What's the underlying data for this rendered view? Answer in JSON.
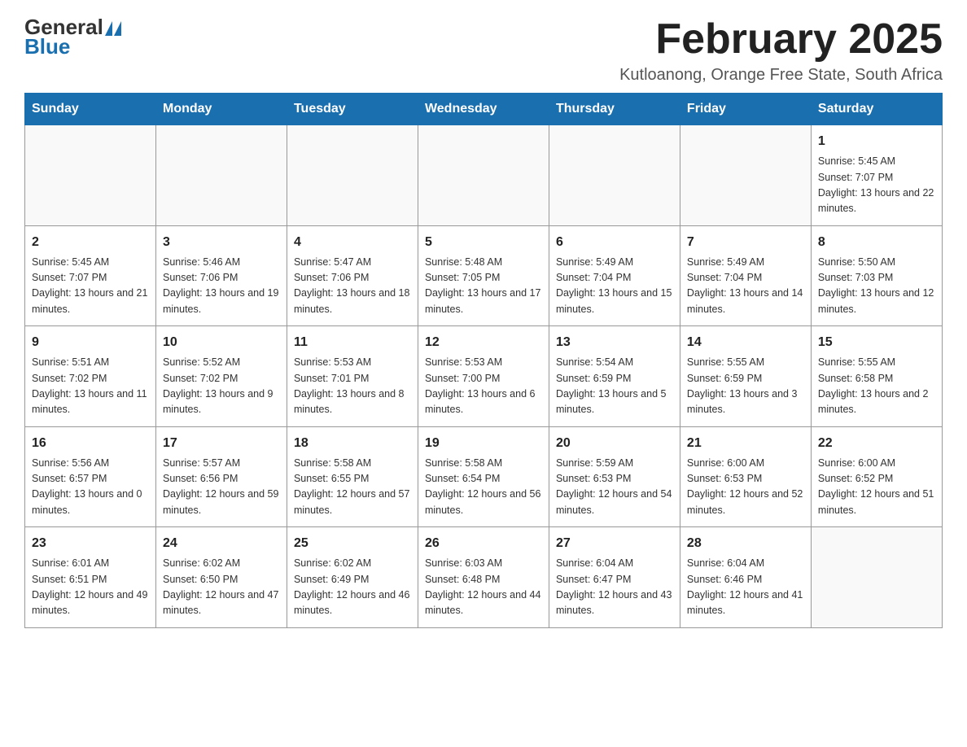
{
  "logo": {
    "general": "General",
    "blue": "Blue"
  },
  "header": {
    "month": "February 2025",
    "location": "Kutloanong, Orange Free State, South Africa"
  },
  "days_of_week": [
    "Sunday",
    "Monday",
    "Tuesday",
    "Wednesday",
    "Thursday",
    "Friday",
    "Saturday"
  ],
  "weeks": [
    [
      {
        "day": "",
        "info": ""
      },
      {
        "day": "",
        "info": ""
      },
      {
        "day": "",
        "info": ""
      },
      {
        "day": "",
        "info": ""
      },
      {
        "day": "",
        "info": ""
      },
      {
        "day": "",
        "info": ""
      },
      {
        "day": "1",
        "info": "Sunrise: 5:45 AM\nSunset: 7:07 PM\nDaylight: 13 hours and 22 minutes."
      }
    ],
    [
      {
        "day": "2",
        "info": "Sunrise: 5:45 AM\nSunset: 7:07 PM\nDaylight: 13 hours and 21 minutes."
      },
      {
        "day": "3",
        "info": "Sunrise: 5:46 AM\nSunset: 7:06 PM\nDaylight: 13 hours and 19 minutes."
      },
      {
        "day": "4",
        "info": "Sunrise: 5:47 AM\nSunset: 7:06 PM\nDaylight: 13 hours and 18 minutes."
      },
      {
        "day": "5",
        "info": "Sunrise: 5:48 AM\nSunset: 7:05 PM\nDaylight: 13 hours and 17 minutes."
      },
      {
        "day": "6",
        "info": "Sunrise: 5:49 AM\nSunset: 7:04 PM\nDaylight: 13 hours and 15 minutes."
      },
      {
        "day": "7",
        "info": "Sunrise: 5:49 AM\nSunset: 7:04 PM\nDaylight: 13 hours and 14 minutes."
      },
      {
        "day": "8",
        "info": "Sunrise: 5:50 AM\nSunset: 7:03 PM\nDaylight: 13 hours and 12 minutes."
      }
    ],
    [
      {
        "day": "9",
        "info": "Sunrise: 5:51 AM\nSunset: 7:02 PM\nDaylight: 13 hours and 11 minutes."
      },
      {
        "day": "10",
        "info": "Sunrise: 5:52 AM\nSunset: 7:02 PM\nDaylight: 13 hours and 9 minutes."
      },
      {
        "day": "11",
        "info": "Sunrise: 5:53 AM\nSunset: 7:01 PM\nDaylight: 13 hours and 8 minutes."
      },
      {
        "day": "12",
        "info": "Sunrise: 5:53 AM\nSunset: 7:00 PM\nDaylight: 13 hours and 6 minutes."
      },
      {
        "day": "13",
        "info": "Sunrise: 5:54 AM\nSunset: 6:59 PM\nDaylight: 13 hours and 5 minutes."
      },
      {
        "day": "14",
        "info": "Sunrise: 5:55 AM\nSunset: 6:59 PM\nDaylight: 13 hours and 3 minutes."
      },
      {
        "day": "15",
        "info": "Sunrise: 5:55 AM\nSunset: 6:58 PM\nDaylight: 13 hours and 2 minutes."
      }
    ],
    [
      {
        "day": "16",
        "info": "Sunrise: 5:56 AM\nSunset: 6:57 PM\nDaylight: 13 hours and 0 minutes."
      },
      {
        "day": "17",
        "info": "Sunrise: 5:57 AM\nSunset: 6:56 PM\nDaylight: 12 hours and 59 minutes."
      },
      {
        "day": "18",
        "info": "Sunrise: 5:58 AM\nSunset: 6:55 PM\nDaylight: 12 hours and 57 minutes."
      },
      {
        "day": "19",
        "info": "Sunrise: 5:58 AM\nSunset: 6:54 PM\nDaylight: 12 hours and 56 minutes."
      },
      {
        "day": "20",
        "info": "Sunrise: 5:59 AM\nSunset: 6:53 PM\nDaylight: 12 hours and 54 minutes."
      },
      {
        "day": "21",
        "info": "Sunrise: 6:00 AM\nSunset: 6:53 PM\nDaylight: 12 hours and 52 minutes."
      },
      {
        "day": "22",
        "info": "Sunrise: 6:00 AM\nSunset: 6:52 PM\nDaylight: 12 hours and 51 minutes."
      }
    ],
    [
      {
        "day": "23",
        "info": "Sunrise: 6:01 AM\nSunset: 6:51 PM\nDaylight: 12 hours and 49 minutes."
      },
      {
        "day": "24",
        "info": "Sunrise: 6:02 AM\nSunset: 6:50 PM\nDaylight: 12 hours and 47 minutes."
      },
      {
        "day": "25",
        "info": "Sunrise: 6:02 AM\nSunset: 6:49 PM\nDaylight: 12 hours and 46 minutes."
      },
      {
        "day": "26",
        "info": "Sunrise: 6:03 AM\nSunset: 6:48 PM\nDaylight: 12 hours and 44 minutes."
      },
      {
        "day": "27",
        "info": "Sunrise: 6:04 AM\nSunset: 6:47 PM\nDaylight: 12 hours and 43 minutes."
      },
      {
        "day": "28",
        "info": "Sunrise: 6:04 AM\nSunset: 6:46 PM\nDaylight: 12 hours and 41 minutes."
      },
      {
        "day": "",
        "info": ""
      }
    ]
  ]
}
